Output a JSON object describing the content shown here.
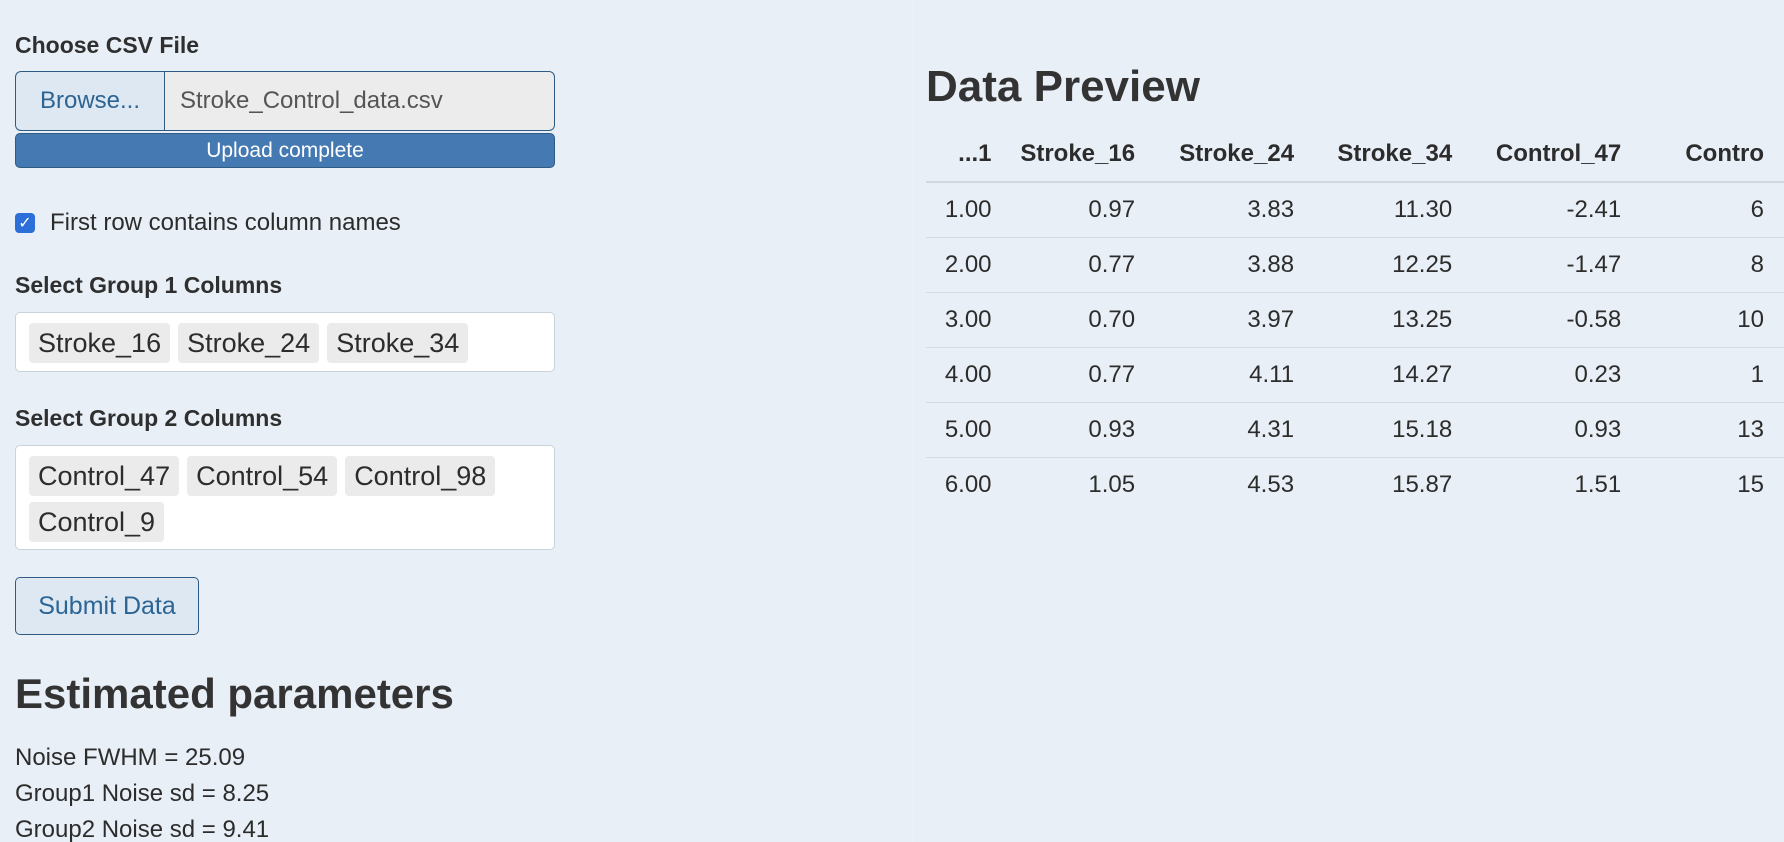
{
  "file_input": {
    "label": "Choose CSV File",
    "browse_label": "Browse...",
    "file_name": "Stroke_Control_data.csv",
    "progress_text": "Upload complete",
    "progress": 1.0
  },
  "header_checkbox": {
    "label": "First row contains column names",
    "checked": true
  },
  "group1": {
    "label": "Select Group 1 Columns",
    "selected": [
      "Stroke_16",
      "Stroke_24",
      "Stroke_34"
    ]
  },
  "group2": {
    "label": "Select Group 2 Columns",
    "selected": [
      "Control_47",
      "Control_54",
      "Control_98",
      "Control_9"
    ]
  },
  "submit_label": "Submit Data",
  "estimates": {
    "title": "Estimated parameters",
    "lines": [
      "Noise FWHM = 25.09",
      "Group1 Noise sd = 8.25",
      "Group2 Noise sd = 9.41"
    ]
  },
  "preview": {
    "title": "Data Preview",
    "columns": [
      "...1",
      "Stroke_16",
      "Stroke_24",
      "Stroke_34",
      "Control_47",
      "Contro"
    ],
    "rows": [
      [
        "1.00",
        "0.97",
        "3.83",
        "11.30",
        "-2.41",
        "6"
      ],
      [
        "2.00",
        "0.77",
        "3.88",
        "12.25",
        "-1.47",
        "8"
      ],
      [
        "3.00",
        "0.70",
        "3.97",
        "13.25",
        "-0.58",
        "10"
      ],
      [
        "4.00",
        "0.77",
        "4.11",
        "14.27",
        "0.23",
        "1"
      ],
      [
        "5.00",
        "0.93",
        "4.31",
        "15.18",
        "0.93",
        "13"
      ],
      [
        "6.00",
        "1.05",
        "4.53",
        "15.87",
        "1.51",
        "15"
      ]
    ]
  },
  "colors": {
    "background": "#e8eff6",
    "accent": "#4579b2",
    "button_border": "#2d5b84",
    "checkbox": "#2c6fd8"
  }
}
